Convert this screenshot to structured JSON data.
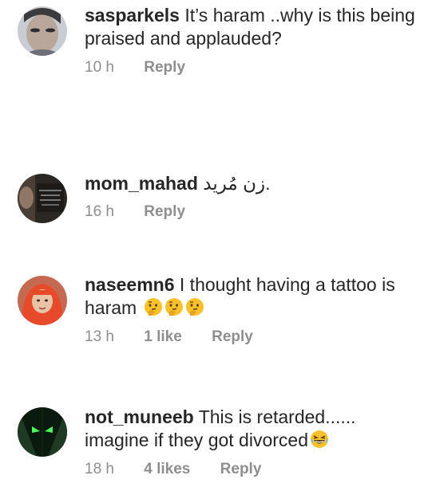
{
  "comments": [
    {
      "username": "sasparkels",
      "text": " It’s haram ..why is this being praised and applauded?",
      "time": "10 h",
      "likes": "",
      "reply": "Reply",
      "emojis": []
    },
    {
      "username": "mom_mahad",
      "text": " زن مُريد.",
      "time": "16 h",
      "likes": "",
      "reply": "Reply",
      "emojis": []
    },
    {
      "username": "naseemn6",
      "text": " I thought having a tattoo is haram ",
      "time": "13 h",
      "likes": "1 like",
      "reply": "Reply",
      "emojis": [
        "thinking-face",
        "thinking-face",
        "thinking-face"
      ]
    },
    {
      "username": "not_muneeb",
      "text": " This is retarded...... imagine if they got divorced",
      "time": "18 h",
      "likes": "4 likes",
      "reply": "Reply",
      "emojis": [
        "laughing-face"
      ]
    }
  ],
  "colors": {
    "text": "#262626",
    "meta": "#8e8e8e",
    "background": "#ffffff",
    "emoji_yellow": "#f7c12b"
  }
}
